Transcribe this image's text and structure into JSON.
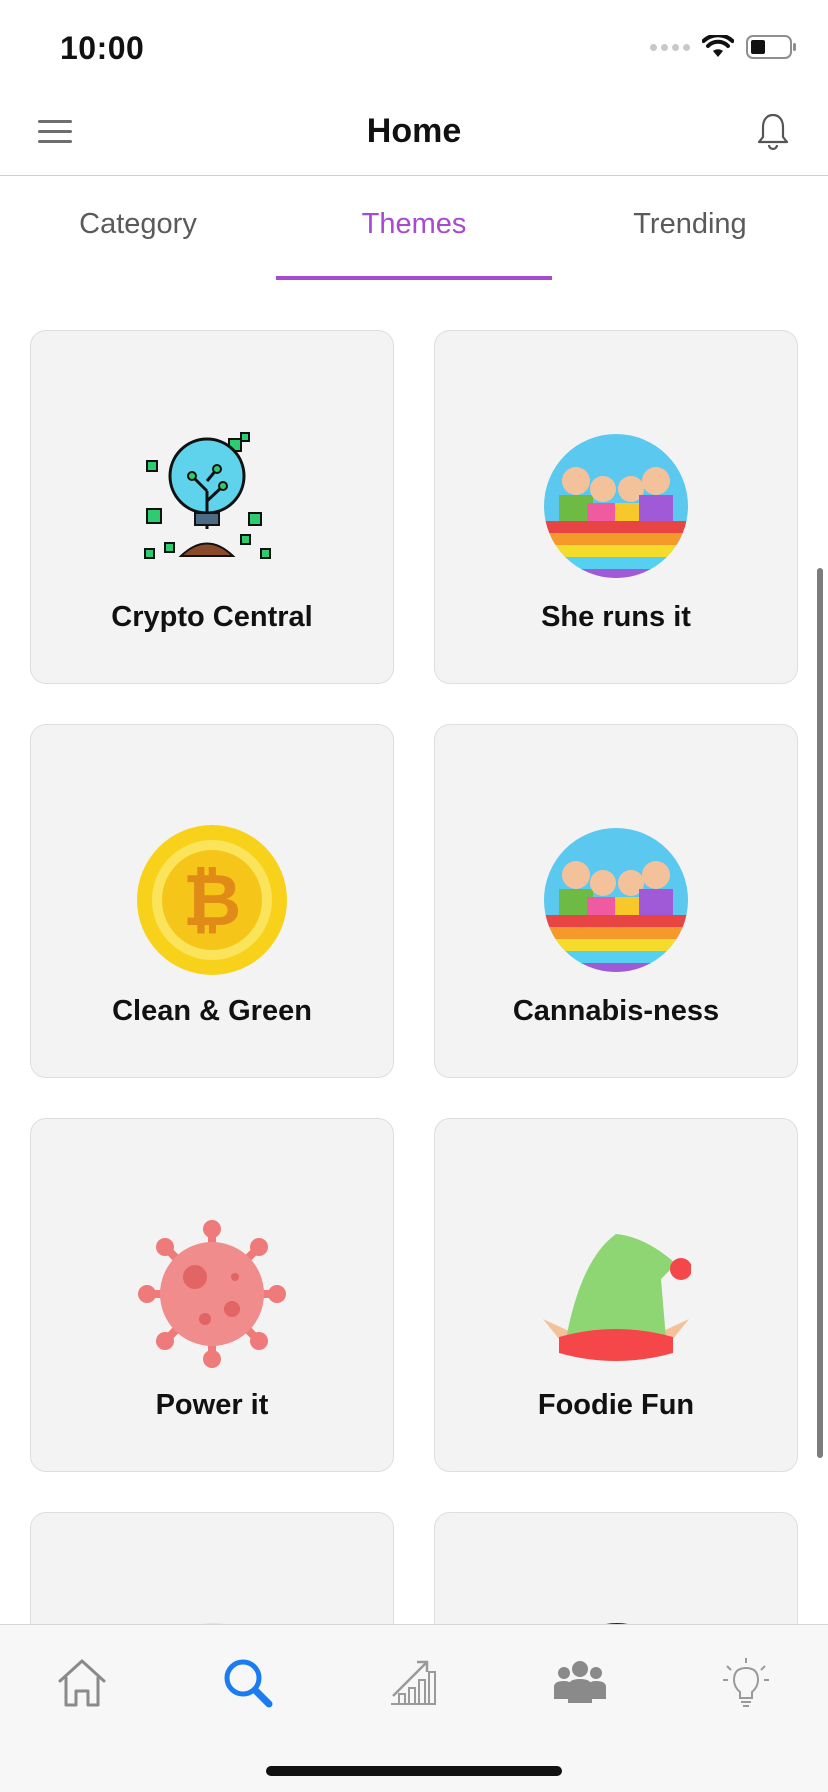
{
  "status_bar": {
    "time": "10:00"
  },
  "header": {
    "title": "Home"
  },
  "tabs": [
    {
      "label": "Category",
      "active": false
    },
    {
      "label": "Themes",
      "active": true
    },
    {
      "label": "Trending",
      "active": false
    }
  ],
  "cards": [
    {
      "label": "Crypto Central",
      "icon": "lightbulb-plant-icon"
    },
    {
      "label": "She runs it",
      "icon": "people-group-icon"
    },
    {
      "label": "Clean & Green",
      "icon": "bitcoin-coin-icon"
    },
    {
      "label": "Cannabis-ness",
      "icon": "people-group-icon"
    },
    {
      "label": "Power it",
      "icon": "virus-icon"
    },
    {
      "label": "Foodie Fun",
      "icon": "elf-hat-icon"
    }
  ],
  "bottom_nav": [
    {
      "name": "home",
      "icon": "home-icon",
      "active": false
    },
    {
      "name": "search",
      "icon": "search-icon",
      "active": true
    },
    {
      "name": "trends",
      "icon": "growth-chart-icon",
      "active": false
    },
    {
      "name": "community",
      "icon": "group-icon",
      "active": false
    },
    {
      "name": "ideas",
      "icon": "lightbulb-icon",
      "active": false
    }
  ],
  "colors": {
    "accent": "#a64bd0",
    "search_active": "#1a7cf0",
    "card_bg": "#f3f3f3"
  }
}
